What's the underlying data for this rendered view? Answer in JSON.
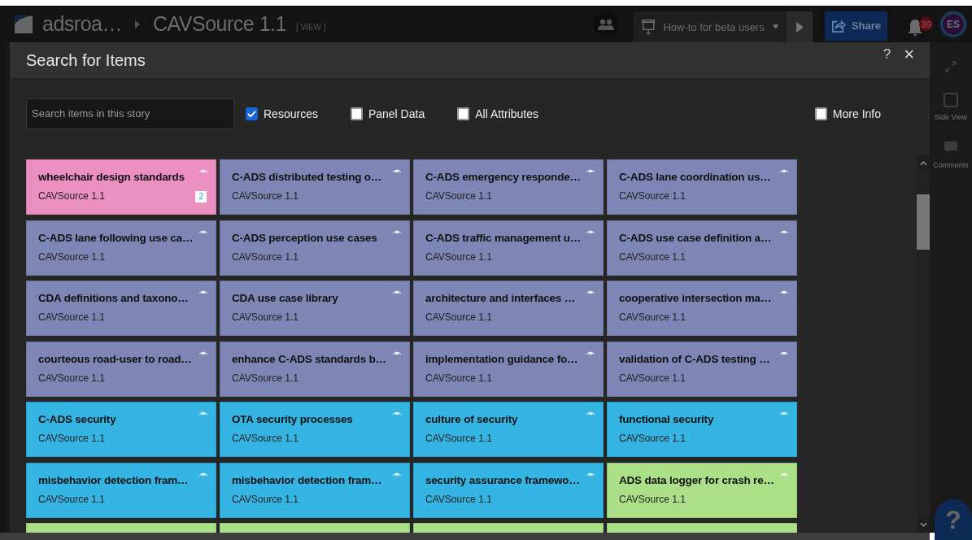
{
  "topbar": {
    "workspace": "adsroa…",
    "story": "CAVSource 1.1",
    "mode": "[ VIEW ]",
    "presentation": "How-to for beta users",
    "share": "Share",
    "notifications": "39",
    "avatar": "ES"
  },
  "dialog": {
    "title": "Search for Items",
    "help": "?",
    "close": "×"
  },
  "search": {
    "placeholder": "Search items in this story"
  },
  "filters": [
    {
      "label": "Resources",
      "checked": true
    },
    {
      "label": "Panel Data",
      "checked": false
    },
    {
      "label": "All Attributes",
      "checked": false
    }
  ],
  "more_info": {
    "label": "More Info",
    "checked": false
  },
  "cards": [
    {
      "title": "wheelchair design standards",
      "source": "CAVSource 1.1",
      "color": "#ec8fc1",
      "comments": "2"
    },
    {
      "title": "C-ADS distributed testing o…",
      "source": "CAVSource 1.1",
      "color": "#7d86b5"
    },
    {
      "title": "C-ADS emergency responde…",
      "source": "CAVSource 1.1",
      "color": "#7d86b5"
    },
    {
      "title": "C-ADS lane coordination us…",
      "source": "CAVSource 1.1",
      "color": "#7d86b5"
    },
    {
      "title": "C-ADS lane following use ca…",
      "source": "CAVSource 1.1",
      "color": "#7d86b5"
    },
    {
      "title": "C-ADS perception use cases",
      "source": "CAVSource 1.1",
      "color": "#7d86b5"
    },
    {
      "title": "C-ADS traffic management u…",
      "source": "CAVSource 1.1",
      "color": "#7d86b5"
    },
    {
      "title": "C-ADS use case definition a…",
      "source": "CAVSource 1.1",
      "color": "#7d86b5"
    },
    {
      "title": "CDA definitions and taxono…",
      "source": "CAVSource 1.1",
      "color": "#7d86b5"
    },
    {
      "title": "CDA use case library",
      "source": "CAVSource 1.1",
      "color": "#7d86b5"
    },
    {
      "title": "architecture and interfaces …",
      "source": "CAVSource 1.1",
      "color": "#7d86b5"
    },
    {
      "title": "cooperative intersection ma…",
      "source": "CAVSource 1.1",
      "color": "#7d86b5"
    },
    {
      "title": "courteous road-user to road…",
      "source": "CAVSource 1.1",
      "color": "#7d86b5"
    },
    {
      "title": "enhance C-ADS standards b…",
      "source": "CAVSource 1.1",
      "color": "#7d86b5"
    },
    {
      "title": "implementation guidance fo…",
      "source": "CAVSource 1.1",
      "color": "#7d86b5"
    },
    {
      "title": "validation of C-ADS testing …",
      "source": "CAVSource 1.1",
      "color": "#7d86b5"
    },
    {
      "title": "C-ADS security",
      "source": "CAVSource 1.1",
      "color": "#35b5e3"
    },
    {
      "title": "OTA security processes",
      "source": "CAVSource 1.1",
      "color": "#35b5e3"
    },
    {
      "title": "culture of security",
      "source": "CAVSource 1.1",
      "color": "#35b5e3"
    },
    {
      "title": "functional security",
      "source": "CAVSource 1.1",
      "color": "#35b5e3"
    },
    {
      "title": "misbehavior detection fram…",
      "source": "CAVSource 1.1",
      "color": "#35b5e3"
    },
    {
      "title": "misbehavior detection fram…",
      "source": "CAVSource 1.1",
      "color": "#35b5e3"
    },
    {
      "title": "security assurance framewo…",
      "source": "CAVSource 1.1",
      "color": "#35b5e3"
    },
    {
      "title": "ADS data logger for crash re…",
      "source": "CAVSource 1.1",
      "color": "#abe089"
    },
    {
      "color": "#abe089"
    },
    {
      "color": "#abe089"
    },
    {
      "color": "#abe089"
    },
    {
      "color": "#abe089"
    }
  ],
  "sidebar": [
    {
      "kind": "expand"
    },
    {
      "kind": "sideview",
      "label": "Side View"
    },
    {
      "kind": "comments",
      "label": "Comments"
    }
  ],
  "help_button": "?"
}
